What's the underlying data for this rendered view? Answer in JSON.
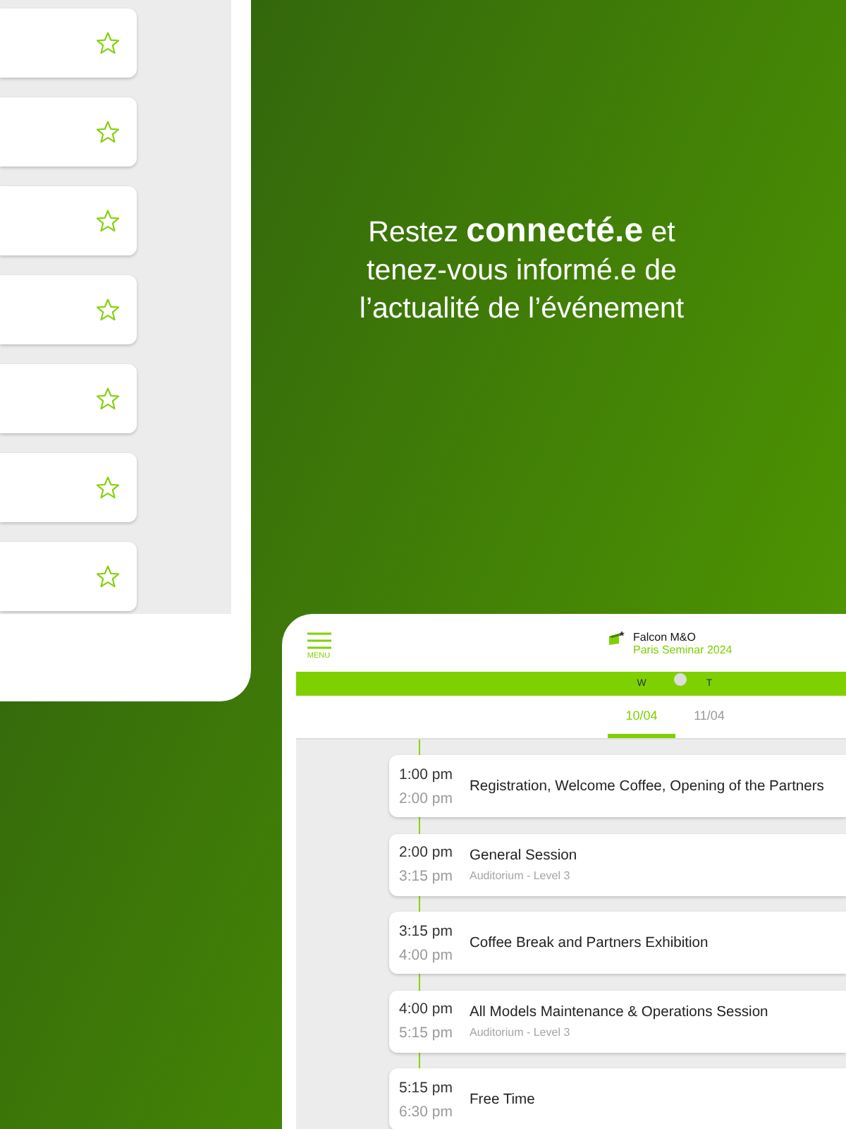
{
  "left_screen": {
    "cards": [
      {
        "favorite": false
      },
      {
        "favorite": false
      },
      {
        "favorite": false
      },
      {
        "favorite": false
      },
      {
        "favorite": false
      },
      {
        "favorite": false
      },
      {
        "favorite": false
      }
    ]
  },
  "tagline": "Restez **connecté.e** et tenez-vous informé.e de l’actualité de l’événement",
  "right_screen": {
    "menu_label": "MENU",
    "logo": {
      "line_1": "Falcon M&O",
      "line_2": "Paris Seminar 2024"
    },
    "days": [
      {
        "weekday": "W",
        "date": "10/04",
        "selected": true
      },
      {
        "weekday": "T",
        "date": "11/04",
        "selected": false
      }
    ],
    "sessions": [
      {
        "start": "1:00 pm",
        "end": "2:00 pm",
        "title": "Registration, Welcome Coffee, Opening of the Partners"
      },
      {
        "start": "2:00 pm",
        "end": "3:15 pm",
        "title": "General Session",
        "location": "Auditorium - Level 3"
      },
      {
        "start": "3:15 pm",
        "end": "4:00 pm",
        "title": "Coffee Break and Partners Exhibition"
      },
      {
        "start": "4:00 pm",
        "end": "5:15 pm",
        "title": "All Models Maintenance & Operations Session",
        "location": "Auditorium - Level 3"
      },
      {
        "start": "5:15 pm",
        "end": "6:30 pm",
        "title": "Free Time"
      }
    ]
  }
}
